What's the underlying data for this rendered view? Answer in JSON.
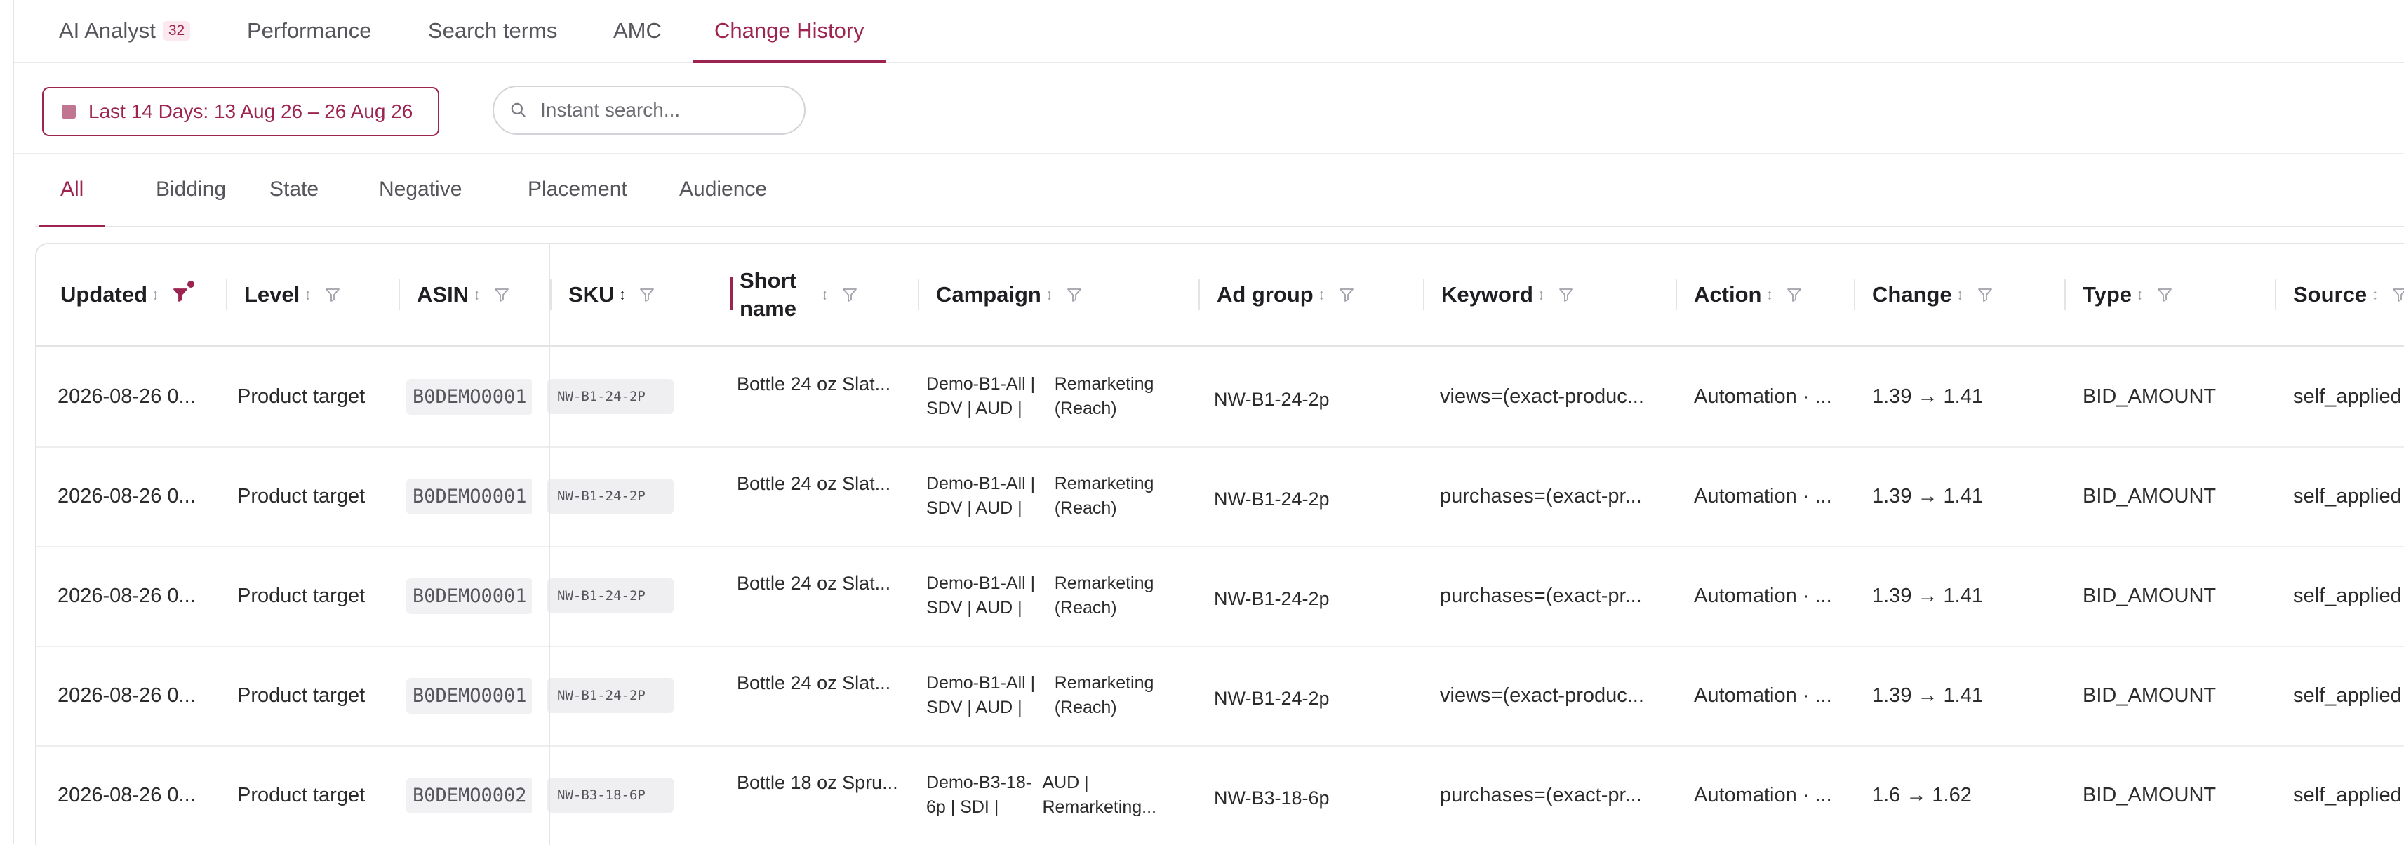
{
  "top_tabs": [
    {
      "label": "AI Analyst",
      "badge": "32"
    },
    {
      "label": "Performance"
    },
    {
      "label": "Search terms"
    },
    {
      "label": "AMC"
    },
    {
      "label": "Change History",
      "active": true
    }
  ],
  "toolbar": {
    "date_range_label": "Last 14 Days: 13 Aug 26 – 26 Aug 26",
    "search_placeholder": "Instant search..."
  },
  "filter_tabs": [
    "All",
    "Bidding",
    "State",
    "Negative",
    "Placement",
    "Audience"
  ],
  "active_filter_tab": "All",
  "columns": [
    {
      "label": "Updated",
      "filter_active": true
    },
    {
      "label": "Level"
    },
    {
      "label": "ASIN"
    },
    {
      "label": "SKU"
    },
    {
      "label": "Short name"
    },
    {
      "label": "Campaign"
    },
    {
      "label": "Ad group"
    },
    {
      "label": "Keyword"
    },
    {
      "label": "Action"
    },
    {
      "label": "Change"
    },
    {
      "label": "Type"
    },
    {
      "label": "Source"
    }
  ],
  "rows": [
    {
      "updated": "2026-08-26 0...",
      "level": "Product target",
      "asin": "B0DEMO0001",
      "sku": "NW-B1-24-2P",
      "short_name": "Bottle 24 oz Slat...",
      "campaign_line1": "Demo-B1-All | SDV | AUD |",
      "campaign_line2": "Remarketing (Reach)",
      "ad_group": "NW-B1-24-2p",
      "keyword": "views=(exact-produc...",
      "action": "Automation · ...",
      "change": "1.39 → 1.41",
      "type": "BID_AMOUNT",
      "source": "self_applied"
    },
    {
      "updated": "2026-08-26 0...",
      "level": "Product target",
      "asin": "B0DEMO0001",
      "sku": "NW-B1-24-2P",
      "short_name": "Bottle 24 oz Slat...",
      "campaign_line1": "Demo-B1-All | SDV | AUD |",
      "campaign_line2": "Remarketing (Reach)",
      "ad_group": "NW-B1-24-2p",
      "keyword": "purchases=(exact-pr...",
      "action": "Automation · ...",
      "change": "1.39 → 1.41",
      "type": "BID_AMOUNT",
      "source": "self_applied"
    },
    {
      "updated": "2026-08-26 0...",
      "level": "Product target",
      "asin": "B0DEMO0001",
      "sku": "NW-B1-24-2P",
      "short_name": "Bottle 24 oz Slat...",
      "campaign_line1": "Demo-B1-All | SDV | AUD |",
      "campaign_line2": "Remarketing (Reach)",
      "ad_group": "NW-B1-24-2p",
      "keyword": "purchases=(exact-pr...",
      "action": "Automation · ...",
      "change": "1.39 → 1.41",
      "type": "BID_AMOUNT",
      "source": "self_applied"
    },
    {
      "updated": "2026-08-26 0...",
      "level": "Product target",
      "asin": "B0DEMO0001",
      "sku": "NW-B1-24-2P",
      "short_name": "Bottle 24 oz Slat...",
      "campaign_line1": "Demo-B1-All | SDV | AUD |",
      "campaign_line2": "Remarketing (Reach)",
      "ad_group": "NW-B1-24-2p",
      "keyword": "views=(exact-produc...",
      "action": "Automation · ...",
      "change": "1.39 → 1.41",
      "type": "BID_AMOUNT",
      "source": "self_applied"
    },
    {
      "updated": "2026-08-26 0...",
      "level": "Product target",
      "asin": "B0DEMO0002",
      "sku": "NW-B3-18-6P",
      "short_name": "Bottle 18 oz Spru...",
      "campaign_line1": "Demo-B3-18-6p | SDI |",
      "campaign_line2": "AUD | Remarketing...",
      "ad_group": "NW-B3-18-6p",
      "keyword": "purchases=(exact-pr...",
      "action": "Automation · ...",
      "change": "1.6 → 1.62",
      "type": "BID_AMOUNT",
      "source": "self_applied"
    }
  ],
  "colors": {
    "accent": "#9d2450",
    "border": "#e4e4e7",
    "muted_text": "#55555c"
  }
}
